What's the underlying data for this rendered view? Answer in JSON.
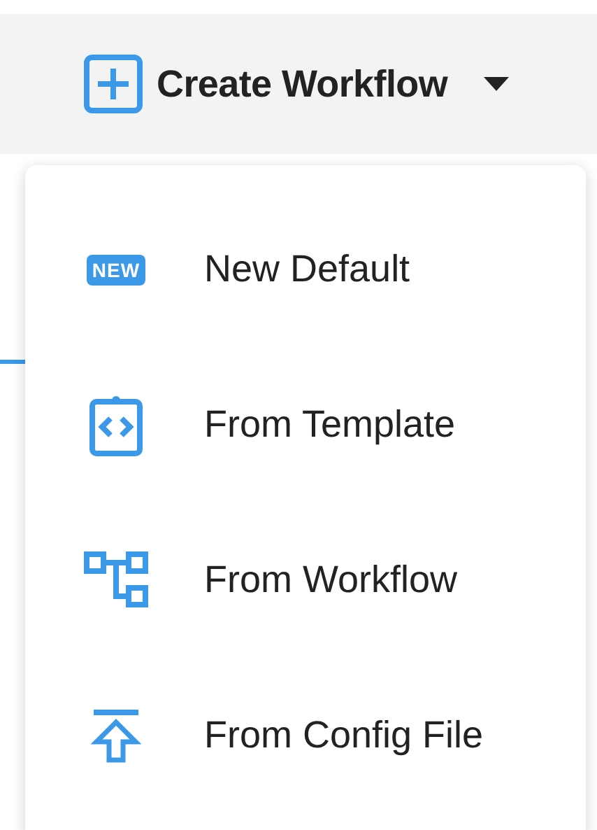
{
  "button": {
    "label": "Create Workflow"
  },
  "menu": {
    "items": [
      {
        "kind": "new",
        "badge": "NEW",
        "label": "New Default"
      },
      {
        "kind": "template",
        "label": "From Template"
      },
      {
        "kind": "workflow",
        "label": "From Workflow"
      },
      {
        "kind": "upload",
        "label": "From Config File"
      }
    ]
  }
}
